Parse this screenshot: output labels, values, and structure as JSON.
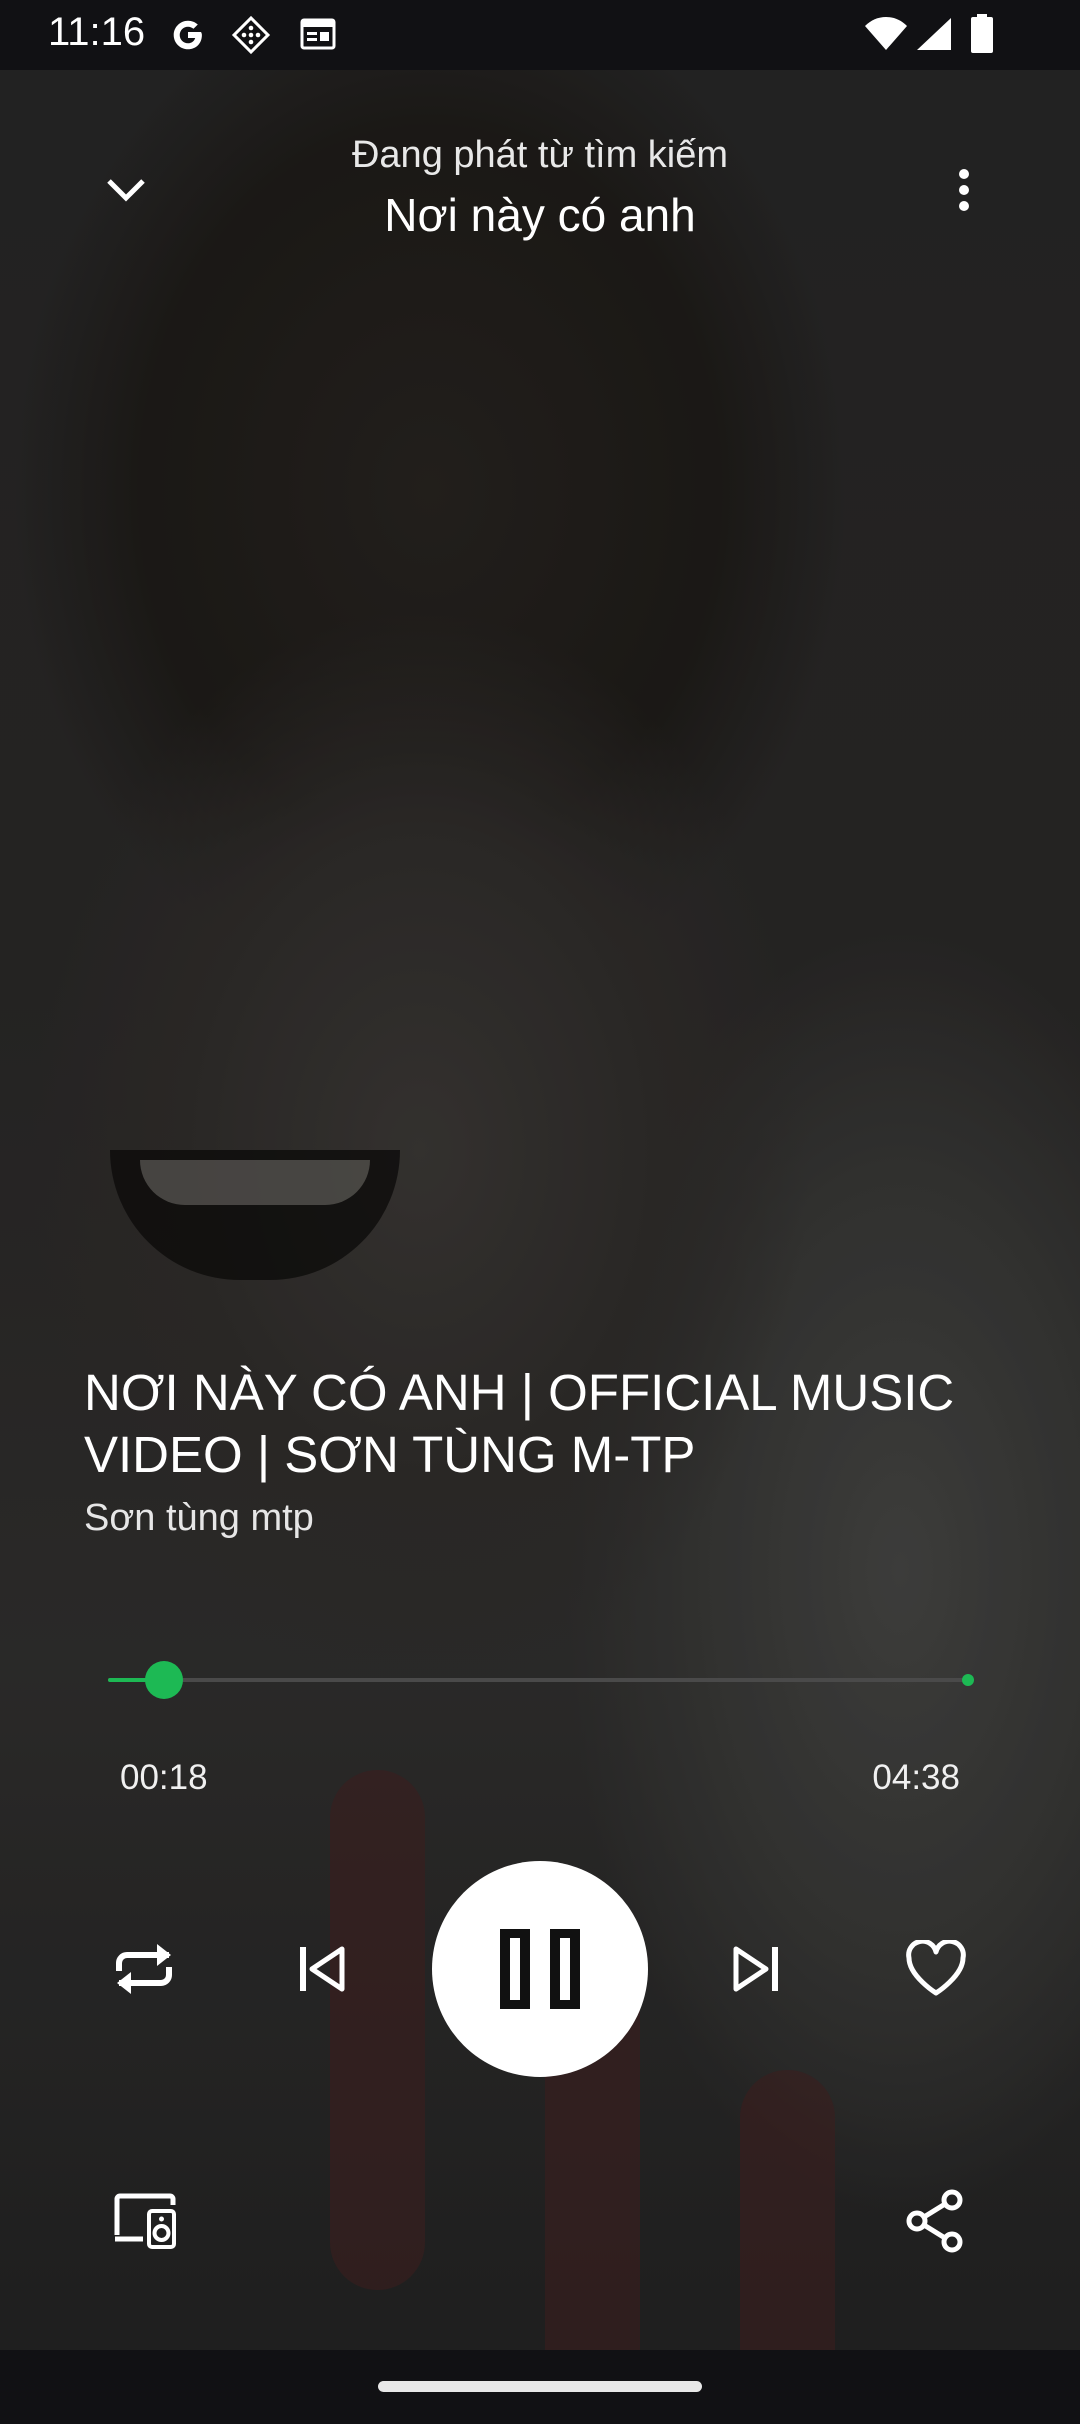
{
  "status_bar": {
    "time": "11:16",
    "left_icons": [
      "google-g-icon",
      "notification-pattern-icon",
      "calendar-icon"
    ],
    "right_icons": [
      "wifi-icon",
      "cellular-signal-icon",
      "battery-icon"
    ]
  },
  "header": {
    "subtitle": "Đang phát từ tìm kiếm",
    "title": "Nơi này có anh"
  },
  "track": {
    "title": "NƠI NÀY CÓ ANH | OFFICIAL MUSIC VIDEO | SƠN TÙNG M-TP",
    "artist": "Sơn tùng mtp"
  },
  "progress": {
    "elapsed": "00:18",
    "total": "04:38",
    "fraction": 0.065
  },
  "controls": [
    "repeat",
    "previous",
    "pause",
    "next",
    "favorite"
  ],
  "bottom_actions": [
    "connect-device",
    "share"
  ],
  "colors": {
    "accent": "#1db954",
    "background": "#161616",
    "bar": "#111114"
  }
}
